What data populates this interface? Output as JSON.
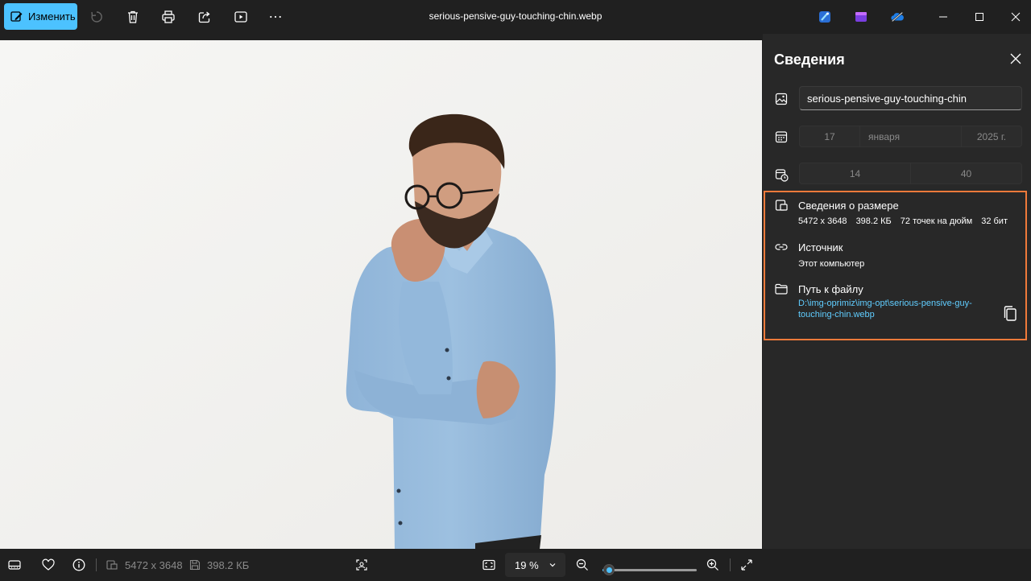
{
  "toolbar": {
    "edit_label": "Изменить",
    "file_title": "serious-pensive-guy-touching-chin.webp"
  },
  "info_panel": {
    "title": "Сведения",
    "file_name": "serious-pensive-guy-touching-chin",
    "date": {
      "day": "17",
      "month": "января",
      "year": "2025 г."
    },
    "time": {
      "hour": "14",
      "minute": "40"
    },
    "size_section": {
      "title": "Сведения о размере",
      "dimensions": "5472 x 3648",
      "file_size": "398.2 КБ",
      "dpi": "72 точек на дюйм",
      "bit_depth": "32 бит"
    },
    "source_section": {
      "title": "Источник",
      "value": "Этот компьютер"
    },
    "path_section": {
      "title": "Путь к файлу",
      "value": "D:\\img-oprimiz\\img-opt\\serious-pensive-guy-touching-chin.webp"
    }
  },
  "status_bar": {
    "dimensions": "5472 x 3648",
    "file_size": "398.2 КБ",
    "zoom": "19 %",
    "zoom_fraction": 0.19
  },
  "colors": {
    "accent": "#4cc2ff",
    "highlight_border": "#f07a3a",
    "link": "#60cdff",
    "background": "#202020",
    "panel": "#282828"
  },
  "icons": {
    "top_left": [
      "edit-icon",
      "rotate-icon",
      "delete-icon",
      "print-icon",
      "share-icon",
      "slideshow-icon",
      "more-icon"
    ],
    "top_right": [
      "designer-icon",
      "clipchamp-icon",
      "onedrive-icon",
      "minimize-icon",
      "maximize-icon",
      "close-icon"
    ],
    "panel": [
      "image-icon",
      "calendar-icon",
      "time-icon",
      "size-icon",
      "link-icon",
      "folder-icon",
      "copy-icon"
    ],
    "bottom": [
      "filmstrip-icon",
      "favorite-icon",
      "info-icon",
      "dimensions-icon",
      "save-icon",
      "scan-icon",
      "fit-icon",
      "zoom-out-icon",
      "zoom-in-icon",
      "fullscreen-icon"
    ]
  }
}
